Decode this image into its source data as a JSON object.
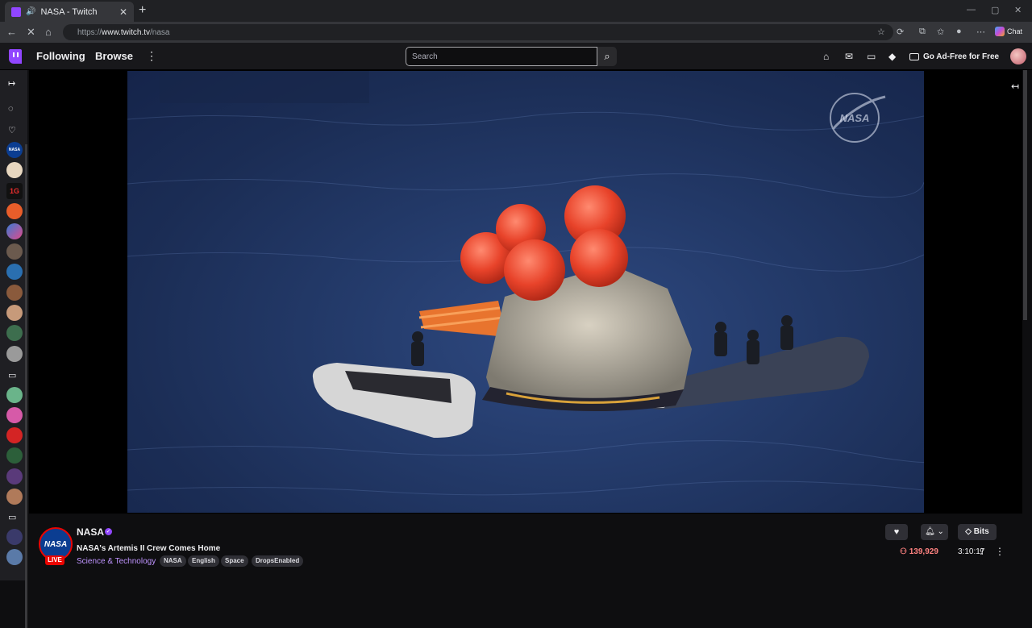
{
  "browser": {
    "tab_title": "NASA - Twitch",
    "url_prefix": "https://",
    "url_host": "www.twitch.tv",
    "url_path": "/nasa",
    "chat_label": "Chat"
  },
  "topnav": {
    "following": "Following",
    "browse": "Browse",
    "search_placeholder": "Search",
    "adfree": "Go Ad-Free for Free"
  },
  "sidebar": {
    "channel_badges": [
      "NASA",
      "1G"
    ]
  },
  "video": {
    "watermark": "NASA"
  },
  "channel": {
    "name": "NASA",
    "live": "LIVE",
    "stream_title": "NASA's Artemis II Crew Comes Home",
    "category": "Science & Technology",
    "tags": [
      "NASA",
      "English",
      "Space",
      "DropsEnabled"
    ],
    "bits": "Bits",
    "viewers": "139,929",
    "uptime": "3:10:17"
  },
  "colors": {
    "twitch_purple": "#9146ff",
    "live_red": "#eb0400",
    "category_purple": "#bf94ff",
    "viewer_red": "#ff8280"
  }
}
